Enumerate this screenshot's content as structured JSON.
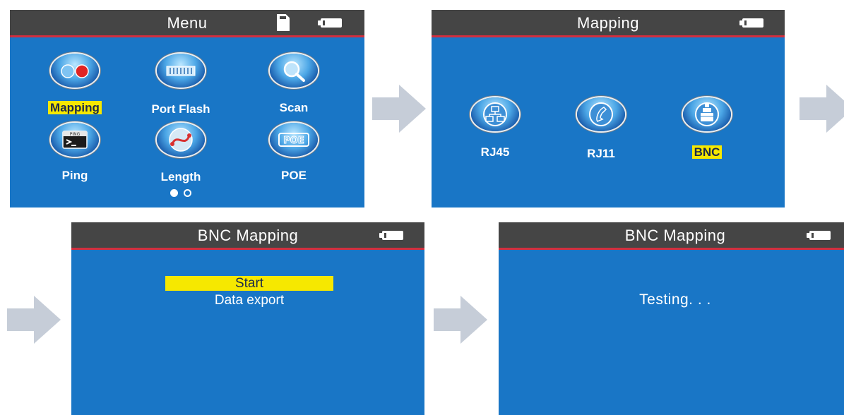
{
  "screen1": {
    "title": "Menu",
    "items": [
      {
        "label": "Mapping",
        "icon": "mapping-icon",
        "selected": true
      },
      {
        "label": "Port Flash",
        "icon": "port-flash-icon",
        "selected": false
      },
      {
        "label": "Scan",
        "icon": "scan-icon",
        "selected": false
      },
      {
        "label": "Ping",
        "icon": "ping-icon",
        "selected": false
      },
      {
        "label": "Length",
        "icon": "length-icon",
        "selected": false
      },
      {
        "label": "POE",
        "icon": "poe-icon",
        "selected": false
      }
    ],
    "ping_icon_text": "PING",
    "poe_icon_text": "POE",
    "page_indicator": {
      "current": 1,
      "total": 2
    }
  },
  "screen2": {
    "title": "Mapping",
    "items": [
      {
        "label": "RJ45",
        "icon": "network-icon",
        "selected": false
      },
      {
        "label": "RJ11",
        "icon": "phone-icon",
        "selected": false
      },
      {
        "label": "BNC",
        "icon": "bnc-connector-icon",
        "selected": true
      }
    ]
  },
  "screen3": {
    "title": "BNC Mapping",
    "menu": [
      {
        "label": "Start",
        "selected": true
      },
      {
        "label": "Data export",
        "selected": false
      }
    ]
  },
  "screen4": {
    "title": "BNC Mapping",
    "status": "Testing. . ."
  },
  "colors": {
    "screen_bg": "#1976c6",
    "titlebar_bg": "#454545",
    "titlebar_border": "#d22f3e",
    "highlight": "#f6e800",
    "arrow": "#c6cdd8"
  }
}
